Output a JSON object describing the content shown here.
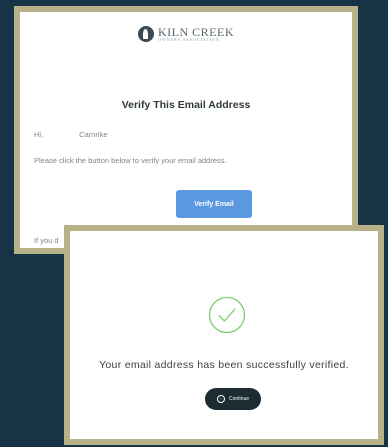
{
  "email_card": {
    "logo_name": "KILN CREEK",
    "logo_sub": "OWNERS ASSOCIATION",
    "heading": "Verify This Email Address",
    "greeting": "Hi,",
    "recipient_name": "Carnrike",
    "instruction": "Please click the button below to verify your email address.",
    "verify_button": "Verify Email",
    "footer_fragment": "If you d"
  },
  "success_card": {
    "icon": "check-circle-icon",
    "message": "Your email address has been successfully verified.",
    "continue_button": "Continue",
    "continue_icon": "arrow-right-circle-icon"
  },
  "colors": {
    "background": "#173446",
    "frame": "#b8b188",
    "verify_button": "#5a98e0",
    "success_green": "#7ccf6a",
    "continue_button": "#1d2b33"
  }
}
